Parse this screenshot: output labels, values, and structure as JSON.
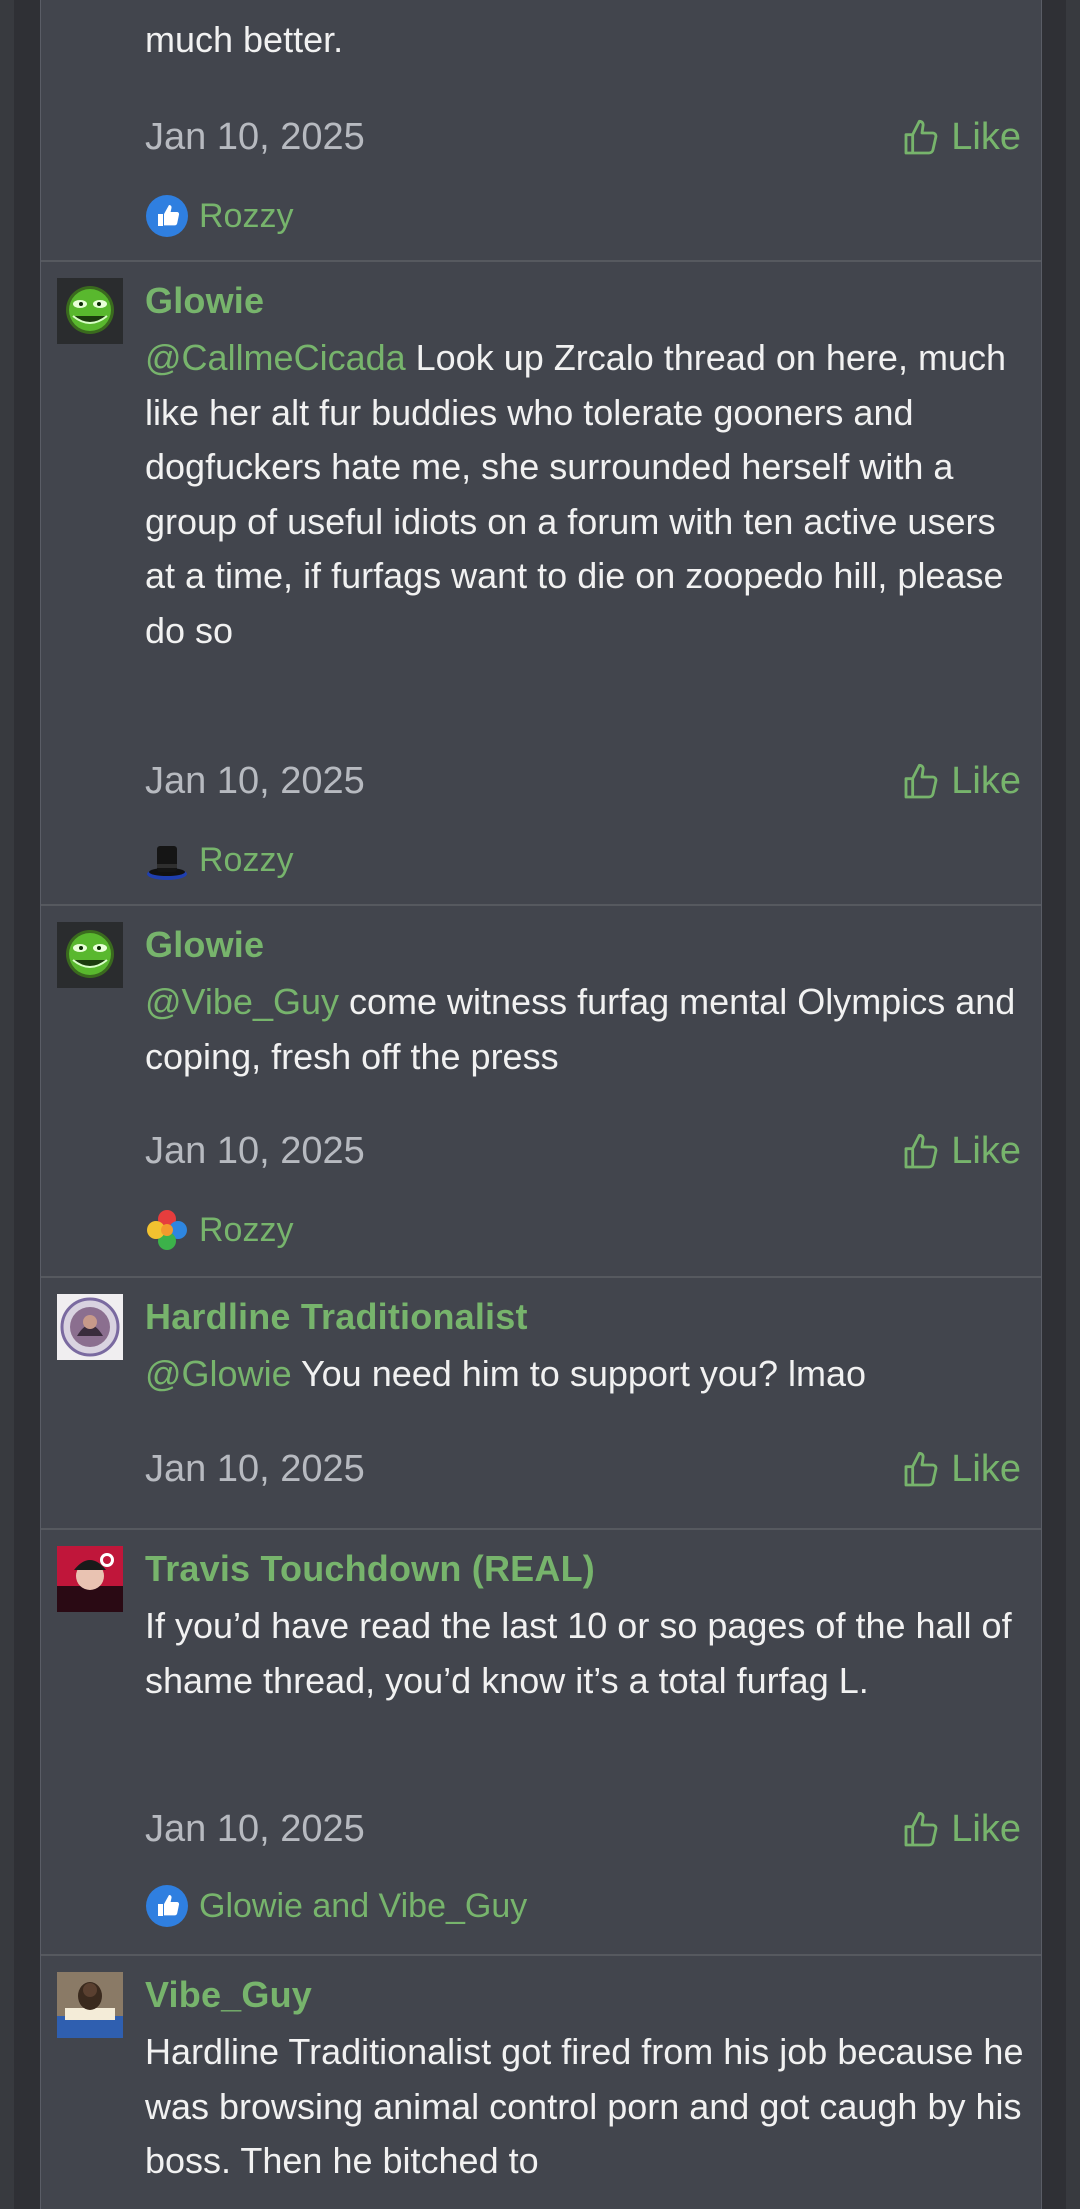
{
  "posts": [
    {
      "body_tail": "much better.",
      "date": "Jan 10, 2025",
      "like_label": "Like",
      "reaction_icon": "thumbs-up-reaction-icon",
      "reactions_by": "Rozzy"
    },
    {
      "author": "Glowie",
      "avatar_icon": "green-troll-face-avatar",
      "mention": "@CallmeCicada",
      "text": " Look up Zrcalo thread on here, much like her alt fur buddies who tolerate gooners and dogfuckers hate me, she surrounded herself with a group of useful idiots on a forum with ten active users at a time, if furfags want to die on zoopedo hill, please do so",
      "date": "Jan 10, 2025",
      "like_label": "Like",
      "reaction_icon": "top-hat-reaction-icon",
      "reactions_by": "Rozzy"
    },
    {
      "author": "Glowie",
      "avatar_icon": "green-troll-face-avatar",
      "mention": "@Vibe_Guy",
      "text": " come witness furfag mental Olympics and coping, fresh off the press",
      "date": "Jan 10, 2025",
      "like_label": "Like",
      "reaction_icon": "puzzle-reaction-icon",
      "reactions_by": "Rozzy"
    },
    {
      "author": "Hardline Traditionalist",
      "avatar_icon": "round-emblem-avatar",
      "mention": "@Glowie",
      "text": " You need him to support you? lmao",
      "date": "Jan 10, 2025",
      "like_label": "Like"
    },
    {
      "author": "Travis Touchdown (REAL)",
      "avatar_icon": "red-character-avatar",
      "text": "If you’d have read the last 10 or so pages of the hall of shame thread, you’d know it’s a total furfag L.",
      "date": "Jan 10, 2025",
      "like_label": "Like",
      "reaction_icon": "thumbs-up-reaction-icon",
      "reactions_by": "Glowie and Vibe_Guy"
    },
    {
      "author": "Vibe_Guy",
      "avatar_icon": "photo-avatar",
      "text": "Hardline Traditionalist got fired from his job because he was browsing animal control porn and got caugh by his boss. Then he bitched to"
    }
  ],
  "colors": {
    "accent": "#77b46c",
    "post_bg": "#42454d",
    "text": "#f1f1f1",
    "muted": "#b7bac0"
  }
}
